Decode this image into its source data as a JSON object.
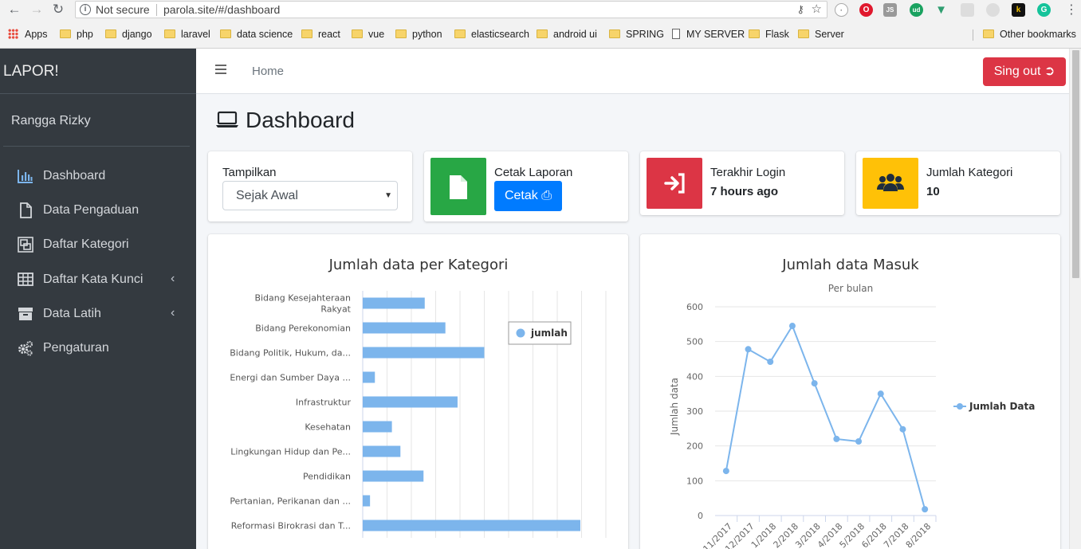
{
  "browser": {
    "not_secure": "Not secure",
    "url": "parola.site/#/dashboard",
    "bookmarks": [
      "Apps",
      "php",
      "django",
      "laravel",
      "data science",
      "react",
      "vue",
      "python",
      "elasticsearch",
      "android ui",
      "SPRING",
      "MY SERVER",
      "Flask",
      "Server"
    ],
    "other_bookmarks": "Other bookmarks"
  },
  "sidebar": {
    "brand": "LAPOR!",
    "user": "Rangga Rizky",
    "items": [
      {
        "label": "Dashboard",
        "icon": "bar-chart-icon",
        "has_children": false
      },
      {
        "label": "Data Pengaduan",
        "icon": "file-icon",
        "has_children": false
      },
      {
        "label": "Daftar Kategori",
        "icon": "object-group-icon",
        "has_children": false
      },
      {
        "label": "Daftar Kata Kunci",
        "icon": "table-icon",
        "has_children": true
      },
      {
        "label": "Data Latih",
        "icon": "archive-icon",
        "has_children": true
      },
      {
        "label": "Pengaturan",
        "icon": "cogs-icon",
        "has_children": false
      }
    ]
  },
  "topbar": {
    "home": "Home",
    "signout": "Sing out"
  },
  "page": {
    "title": "Dashboard"
  },
  "filter": {
    "label": "Tampilkan",
    "selected": "Sejak Awal"
  },
  "cards": {
    "cetak": {
      "label": "Cetak Laporan",
      "button": "Cetak",
      "color": "#28a745"
    },
    "login": {
      "label": "Terakhir Login",
      "value": "7 hours ago",
      "color": "#dc3545"
    },
    "kategori": {
      "label": "Jumlah Kategori",
      "value": "10",
      "color": "#ffc107"
    }
  },
  "colors": {
    "series": "#7cb5ec",
    "sidebar_bg": "#343a40",
    "danger": "#dc3545",
    "primary": "#007bff"
  },
  "chart_data": [
    {
      "type": "bar",
      "orientation": "horizontal",
      "title": "Jumlah data per Kategori",
      "categories": [
        [
          "Bidang Kesejahteraan",
          "Rakyat"
        ],
        [
          "Bidang Perekonomian"
        ],
        [
          "Bidang Politik, Hukum, da..."
        ],
        [
          "Energi dan Sumber Daya ..."
        ],
        [
          "Infrastruktur"
        ],
        [
          "Kesehatan"
        ],
        [
          "Lingkungan Hidup dan Pe..."
        ],
        [
          "Pendidikan"
        ],
        [
          "Pertanian, Perikanan dan ..."
        ],
        [
          "Reformasi Birokrasi dan T..."
        ]
      ],
      "series": [
        {
          "name": "jumlah",
          "values": [
            255,
            340,
            500,
            50,
            390,
            120,
            155,
            250,
            30,
            895
          ]
        }
      ],
      "xlim": [
        0,
        1000
      ],
      "legend": "top-right"
    },
    {
      "type": "line",
      "title": "Jumlah data Masuk",
      "subtitle": "Per bulan",
      "ylabel": "Jumlah data",
      "x": [
        "11/2017",
        "12/2017",
        "1/2018",
        "2/2018",
        "3/2018",
        "4/2018",
        "5/2018",
        "6/2018",
        "7/2018",
        "8/2018"
      ],
      "series": [
        {
          "name": "Jumlah Data",
          "values": [
            128,
            478,
            442,
            545,
            380,
            220,
            213,
            350,
            248,
            18
          ]
        }
      ],
      "ylim": [
        0,
        600
      ],
      "yticks": [
        0,
        100,
        200,
        300,
        400,
        500,
        600
      ],
      "legend": "right"
    }
  ]
}
